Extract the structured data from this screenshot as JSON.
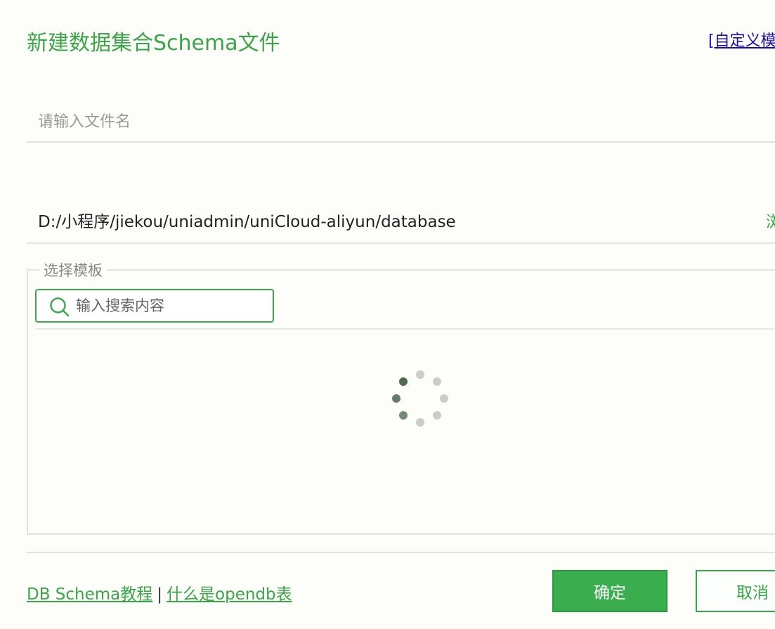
{
  "dialog": {
    "title": "新建数据集合Schema文件",
    "custom_template_link": "[自定义模"
  },
  "filename": {
    "placeholder": "请输入文件名",
    "value": ""
  },
  "path": {
    "value": "D:/小程序/jiekou/uniadmin/uniCloud-aliyun/database",
    "browse_label": "浏"
  },
  "template": {
    "legend": "选择模板",
    "search_placeholder": "输入搜索内容",
    "search_value": "",
    "loading": true
  },
  "footer": {
    "tutorial_link": "DB Schema教程",
    "separator": "|",
    "opendb_link": "什么是opendb表",
    "confirm_label": "确定",
    "cancel_label": "取消"
  },
  "colors": {
    "accent": "#3aa648",
    "button_bg": "#3aae4e",
    "link_blue": "#1a0dab",
    "background": "#fdfdf9"
  }
}
